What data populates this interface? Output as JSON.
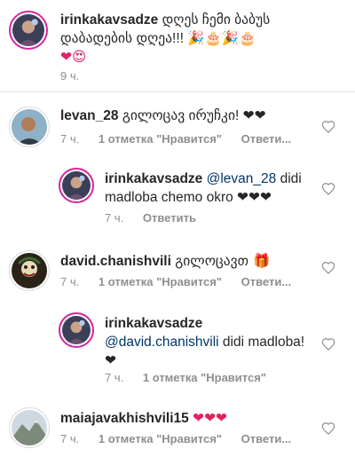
{
  "caption": {
    "username": "irinkakavsadze",
    "text": "დღეს ჩემი ბაბუს დაბადების დღეა!!! 🎉🎂🎉🎂",
    "emoji_line": "❤😍",
    "time": "9 ч."
  },
  "comments": [
    {
      "username": "levan_28",
      "text": "გილოცავ ირუჩკი! ❤❤",
      "time": "7 ч.",
      "likes": "1 отметка \"Нравится\"",
      "reply": "Ответи..."
    },
    {
      "username": "irinkakavsadze",
      "mention": "@levan_28",
      "text": " didi madloba chemo okro ❤❤❤",
      "time": "7 ч.",
      "reply": "Ответить"
    },
    {
      "username": "david.chanishvili",
      "text": "გილოცავთ 🎁",
      "time": "7 ч.",
      "likes": "1 отметка \"Нравится\"",
      "reply": "Ответи..."
    },
    {
      "username": "irinkakavsadze",
      "mention": "@david.chanishvili",
      "text": " didi madloba! ❤",
      "time": "7 ч.",
      "likes": "1 отметка \"Нравится\""
    },
    {
      "username": "maiajavakhishvili15",
      "text": "❤❤❤",
      "time": "7 ч.",
      "likes": "1 отметка \"Нравится\"",
      "reply": "Ответи..."
    }
  ],
  "colors": {
    "story_ring": "#d6249f",
    "meta_grey": "#8e8e8e",
    "mention_blue": "#003569",
    "heart_red": "#e0245e"
  },
  "icons": {
    "like": "heart-outline-icon"
  }
}
